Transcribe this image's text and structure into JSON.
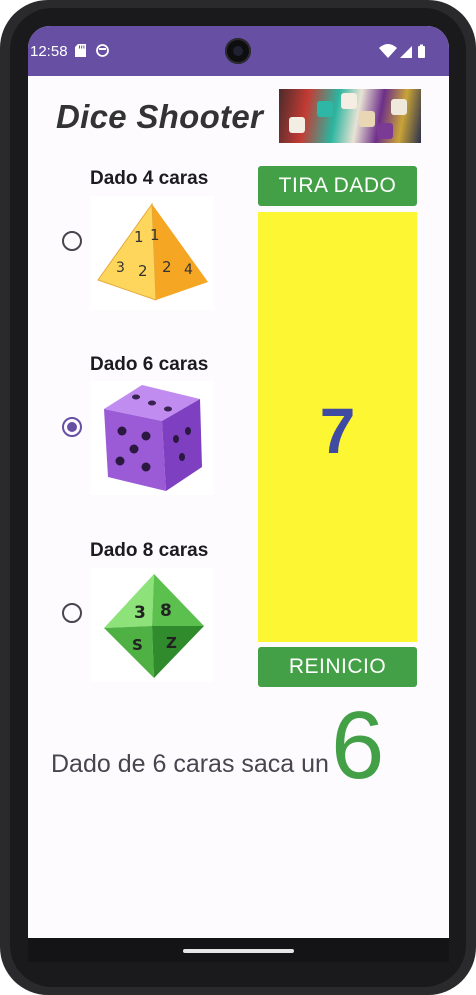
{
  "status_bar": {
    "time": "12:58",
    "icon_names": [
      "sd-card-icon",
      "system-notification-icon",
      "wifi-icon",
      "signal-icon",
      "battery-icon"
    ]
  },
  "app": {
    "title": "Dice Shooter"
  },
  "dice_options": [
    {
      "label": "Dado 4 caras",
      "selected": false,
      "icon": "d4-pyramid-die-icon",
      "color": "#f7c544"
    },
    {
      "label": "Dado 6 caras",
      "selected": true,
      "icon": "d6-cube-die-icon",
      "color": "#9b5bd6"
    },
    {
      "label": "Dado 8 caras",
      "selected": false,
      "icon": "d8-octahedron-die-icon",
      "color": "#4fbf4a"
    }
  ],
  "actions": {
    "roll_label": "TIRA DADO",
    "reset_label": "REINICIO"
  },
  "display": {
    "value": "7"
  },
  "result": {
    "text": "Dado de 6 caras saca un",
    "value": "6"
  },
  "colors": {
    "status_bar": "#6750a4",
    "button": "#43a047",
    "panel": "#fdf632",
    "panel_number": "#3f4aa3",
    "result_value": "#43a047"
  }
}
